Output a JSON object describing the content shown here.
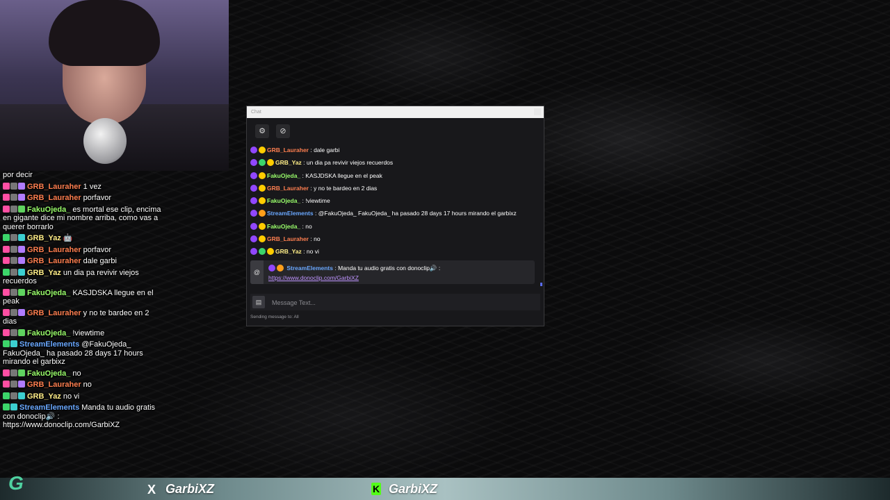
{
  "side_chat": {
    "first_line": "por decir",
    "lines": [
      {
        "user": "GRB_Lauraher",
        "color": "#ff7f50",
        "badges": [
          "#ff4fa3",
          "#777",
          "#b07cff"
        ],
        "text": "1 vez"
      },
      {
        "user": "GRB_Lauraher",
        "color": "#ff7f50",
        "badges": [
          "#ff4fa3",
          "#777",
          "#b07cff"
        ],
        "text": "porfavor"
      },
      {
        "user": "FakuOjeda_",
        "color": "#9aff6b",
        "badges": [
          "#ff4fa3",
          "#777",
          "#5fd35f"
        ],
        "text": "es mortal ese clip, encima en gigante dice mi nombre arriba, como vas a querer borrarlo"
      },
      {
        "user": "GRB_Yaz",
        "color": "#ffee88",
        "badges": [
          "#3cd56a",
          "#777",
          "#3ccfd0"
        ],
        "text": "🤖"
      },
      {
        "user": "GRB_Lauraher",
        "color": "#ff7f50",
        "badges": [
          "#ff4fa3",
          "#777",
          "#b07cff"
        ],
        "text": "porfavor"
      },
      {
        "user": "GRB_Lauraher",
        "color": "#ff7f50",
        "badges": [
          "#ff4fa3",
          "#777",
          "#b07cff"
        ],
        "text": "dale garbi"
      },
      {
        "user": "GRB_Yaz",
        "color": "#ffee88",
        "badges": [
          "#3cd56a",
          "#777",
          "#3ccfd0"
        ],
        "text": "un dia pa revivir viejos recuerdos"
      },
      {
        "user": "FakuOjeda_",
        "color": "#9aff6b",
        "badges": [
          "#ff4fa3",
          "#777",
          "#5fd35f"
        ],
        "text": "KASJDSKA llegue en el peak"
      },
      {
        "user": "GRB_Lauraher",
        "color": "#ff7f50",
        "badges": [
          "#ff4fa3",
          "#777",
          "#b07cff"
        ],
        "text": "y no te bardeo en 2 dias"
      },
      {
        "user": "FakuOjeda_",
        "color": "#9aff6b",
        "badges": [
          "#ff4fa3",
          "#777",
          "#5fd35f"
        ],
        "text": "!viewtime"
      },
      {
        "user": "StreamElements",
        "color": "#6aa8ff",
        "badges": [
          "#3cd56a",
          "#3ccfd0"
        ],
        "text": "@FakuOjeda_ FakuOjeda_ ha pasado 28 days 17 hours mirando el garbixz"
      },
      {
        "user": "FakuOjeda_",
        "color": "#9aff6b",
        "badges": [
          "#ff4fa3",
          "#777",
          "#5fd35f"
        ],
        "text": "no"
      },
      {
        "user": "GRB_Lauraher",
        "color": "#ff7f50",
        "badges": [
          "#ff4fa3",
          "#777",
          "#b07cff"
        ],
        "text": "no"
      },
      {
        "user": "GRB_Yaz",
        "color": "#ffee88",
        "badges": [
          "#3cd56a",
          "#777",
          "#3ccfd0"
        ],
        "text": "no vi"
      },
      {
        "user": "StreamElements",
        "color": "#6aa8ff",
        "badges": [
          "#3cd56a",
          "#3ccfd0"
        ],
        "text": "Manda tu audio gratis con donoclip🔊 : https://www.donoclip.com/GarbiXZ"
      }
    ]
  },
  "bottom_bar": {
    "twitter_handle": "GarbiXZ",
    "kick_handle": "GarbiXZ",
    "x_glyph": "X",
    "k_glyph": "K"
  },
  "chat_window": {
    "title": "Chat",
    "messages": [
      {
        "badges": [
          "#9147ff",
          "#ffcc00"
        ],
        "user": "GRB_Lauraher",
        "color": "#ff7f50",
        "text": "dale garbi"
      },
      {
        "badges": [
          "#9147ff",
          "#3cd56a",
          "#ffcc00"
        ],
        "user": "GRB_Yaz",
        "color": "#ffee88",
        "text": "un dia pa revivir viejos recuerdos"
      },
      {
        "badges": [
          "#9147ff",
          "#ffcc00"
        ],
        "user": "FakuOjeda_",
        "color": "#9aff6b",
        "text": "KASJDSKA llegue en el peak"
      },
      {
        "badges": [
          "#9147ff",
          "#ffcc00"
        ],
        "user": "GRB_Lauraher",
        "color": "#ff7f50",
        "text": "y no te bardeo en 2 dias"
      },
      {
        "badges": [
          "#9147ff",
          "#ffcc00"
        ],
        "user": "FakuOjeda_",
        "color": "#9aff6b",
        "text": "!viewtime"
      },
      {
        "badges": [
          "#9147ff",
          "#ff9f1a"
        ],
        "user": "StreamElements",
        "color": "#6aa8ff",
        "text": "@FakuOjeda_ FakuOjeda_ ha pasado 28 days 17 hours mirando el garbixz"
      },
      {
        "badges": [
          "#9147ff",
          "#ffcc00"
        ],
        "user": "FakuOjeda_",
        "color": "#9aff6b",
        "text": "no"
      },
      {
        "badges": [
          "#9147ff",
          "#ffcc00"
        ],
        "user": "GRB_Lauraher",
        "color": "#ff7f50",
        "text": "no"
      },
      {
        "badges": [
          "#9147ff",
          "#3cd56a",
          "#ffcc00"
        ],
        "user": "GRB_Yaz",
        "color": "#ffee88",
        "text": "no vi"
      }
    ],
    "pinned": {
      "user": "StreamElements",
      "text": "Manda tu audio gratis con donoclip🔊 :",
      "link": "https://www.donoclip.com/GarbiXZ"
    },
    "input_placeholder": "Message Text...",
    "sending_to": "Sending message to: All"
  }
}
